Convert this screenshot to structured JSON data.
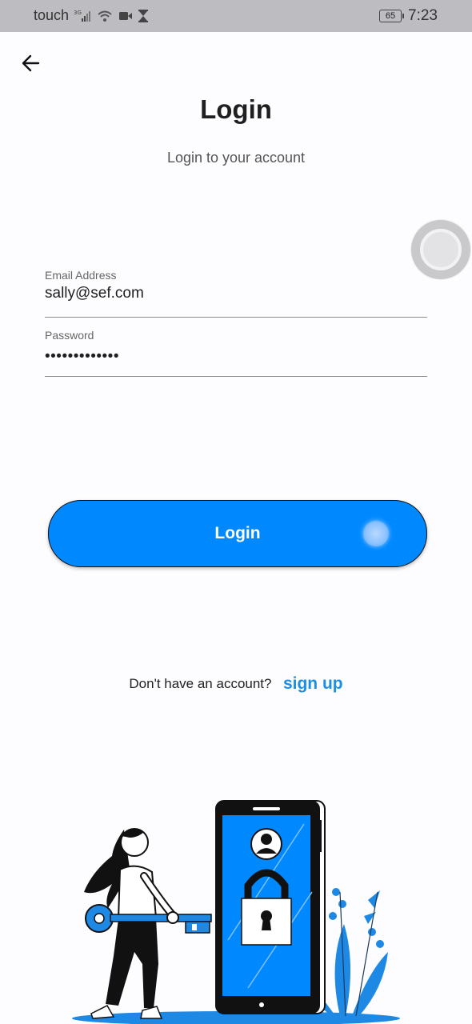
{
  "status_bar": {
    "carrier": "touch",
    "signal_badge": "3G",
    "battery_level": "65",
    "time": "7:23",
    "icons": [
      "signal-icon",
      "wifi-icon",
      "video-camera-icon",
      "hourglass-icon"
    ]
  },
  "header": {
    "back_icon": "arrow-left-icon",
    "title": "Login",
    "subtitle": "Login to your account"
  },
  "form": {
    "email": {
      "label": "Email Address",
      "value": "sally@sef.com"
    },
    "password": {
      "label": "Password",
      "value": "•••••••••••••"
    }
  },
  "actions": {
    "login_label": "Login",
    "signup_prompt": "Don't have an account?",
    "signup_label": "sign up"
  },
  "colors": {
    "accent": "#0089ff",
    "link": "#1a8fe3",
    "background": "#fdfcfe",
    "status_bar": "#bdbcc1"
  }
}
